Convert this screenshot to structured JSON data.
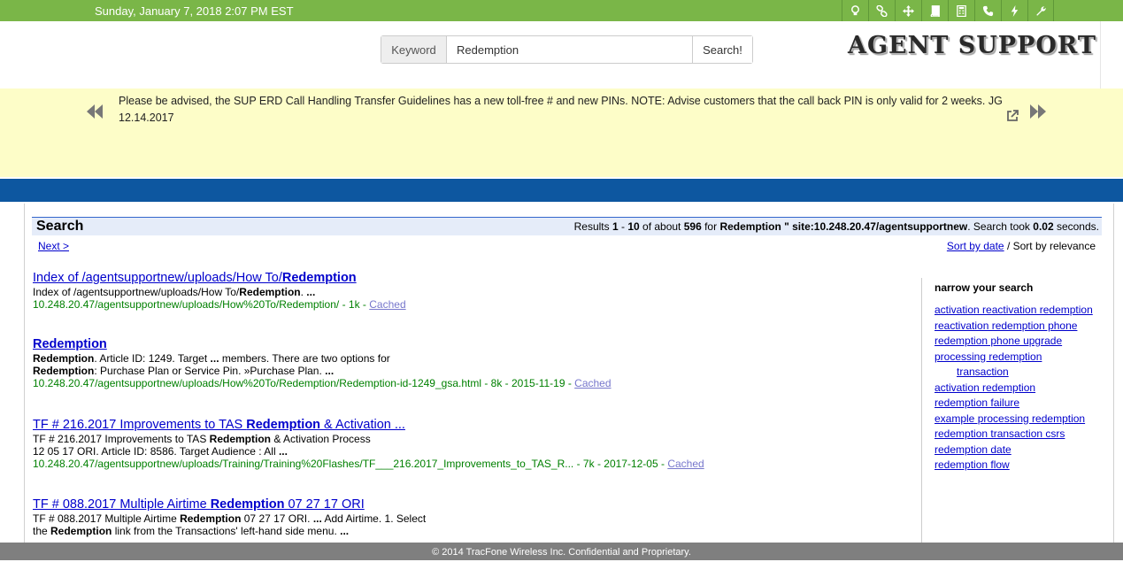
{
  "topbar": {
    "date": "Sunday, January 7, 2018 2:07 PM EST",
    "tools": [
      "lightbulb-icon",
      "link-icon",
      "move-arrows-icon",
      "book-icon",
      "calculator-icon",
      "phone-icon",
      "bolt-icon",
      "wrench-icon"
    ]
  },
  "search": {
    "label": "Keyword",
    "value": "Redemption",
    "button": "Search!"
  },
  "logo": "AGENT SUPPORT",
  "announcement": {
    "text": "Please be advised, the SUP ERD Call Handling Transfer Guidelines has a new toll-free # and new PINs.  NOTE: Advise customers that the call back PIN is only valid for 2 weeks. JG 12.14.2017"
  },
  "results_header": {
    "title": "Search",
    "stats_prefix": "Results ",
    "from": "1",
    "dash": " - ",
    "to": "10",
    "of_text": " of about ",
    "total": "596",
    "for_text": " for ",
    "query": "Redemption \" site:10.248.20.47/agentsupportnew",
    "took_text": ". Search took ",
    "seconds": "0.02",
    "seconds_text": " seconds."
  },
  "next": "Next >",
  "sort": {
    "by_date": "Sort by date",
    "sep": " / Sort by relevance"
  },
  "results": [
    {
      "title_pre": "Index of /agentsupportnew/uploads/How To/",
      "title_bold": "Redemption",
      "title_post": "",
      "snippet": [
        {
          "t": "Index of /agentsupportnew/uploads/How To/",
          "b": false
        },
        {
          "t": "Redemption",
          "b": true
        },
        {
          "t": ". ",
          "b": false
        },
        {
          "t": "...",
          "b": true
        }
      ],
      "snippet2": [],
      "url": "10.248.20.47/agentsupportnew/uploads/How%20To/Redemption/ - 1k - ",
      "cached": "Cached"
    },
    {
      "title_pre": "",
      "title_bold": "Redemption",
      "title_post": "",
      "snippet": [
        {
          "t": "Redemption",
          "b": true
        },
        {
          "t": ". Article ID: 1249. Target ",
          "b": false
        },
        {
          "t": "...",
          "b": true
        },
        {
          "t": " members. There are two options for",
          "b": false
        }
      ],
      "snippet2": [
        {
          "t": "Redemption",
          "b": true
        },
        {
          "t": ": Purchase Plan or Service Pin. »Purchase Plan. ",
          "b": false
        },
        {
          "t": "...",
          "b": true
        }
      ],
      "url": "10.248.20.47/agentsupportnew/uploads/How%20To/Redemption/Redemption-id-1249_gsa.html - 8k - 2015-11-19 - ",
      "cached": "Cached"
    },
    {
      "title_pre": "TF # 216.2017 Improvements to TAS ",
      "title_bold": "Redemption",
      "title_post": " & Activation ...",
      "snippet": [
        {
          "t": "TF # 216.2017 Improvements to TAS ",
          "b": false
        },
        {
          "t": "Redemption",
          "b": true
        },
        {
          "t": " & Activation Process",
          "b": false
        }
      ],
      "snippet2": [
        {
          "t": "12 05 17 ORI. Article ID: 8586. Target Audience : All ",
          "b": false
        },
        {
          "t": "...",
          "b": true
        }
      ],
      "url": "10.248.20.47/agentsupportnew/uploads/Training/Training%20Flashes/TF___216.2017_Improvements_to_TAS_R... - 7k - 2017-12-05 - ",
      "cached": "Cached"
    },
    {
      "title_pre": "TF # 088.2017 Multiple Airtime ",
      "title_bold": "Redemption",
      "title_post": " 07 27 17 ORI",
      "snippet": [
        {
          "t": "TF # 088.2017 Multiple Airtime ",
          "b": false
        },
        {
          "t": "Redemption",
          "b": true
        },
        {
          "t": " 07 27 17 ORI. ",
          "b": false
        },
        {
          "t": "...",
          "b": true
        },
        {
          "t": " Add Airtime. 1. Select",
          "b": false
        }
      ],
      "snippet2": [
        {
          "t": "the ",
          "b": false
        },
        {
          "t": "Redemption",
          "b": true
        },
        {
          "t": " link from the Transactions' left-hand side menu. ",
          "b": false
        },
        {
          "t": "...",
          "b": true
        }
      ],
      "url": "",
      "cached": ""
    }
  ],
  "narrow": {
    "title": "narrow your search",
    "items": [
      "activation reactivation redemption",
      "reactivation redemption phone",
      "redemption phone upgrade",
      "processing redemption",
      "transaction",
      "activation redemption",
      "redemption failure",
      "example processing redemption",
      "redemption transaction csrs",
      "redemption date",
      "redemption flow"
    ]
  },
  "footer": "© 2014 TracFone Wireless Inc. Confidential and Proprietary.",
  "colors": {
    "topbar": "#7ab648",
    "bluebar": "#0d57a0",
    "announce_bg": "#fdfdc8",
    "link": "#0000cc",
    "url": "#008000"
  }
}
